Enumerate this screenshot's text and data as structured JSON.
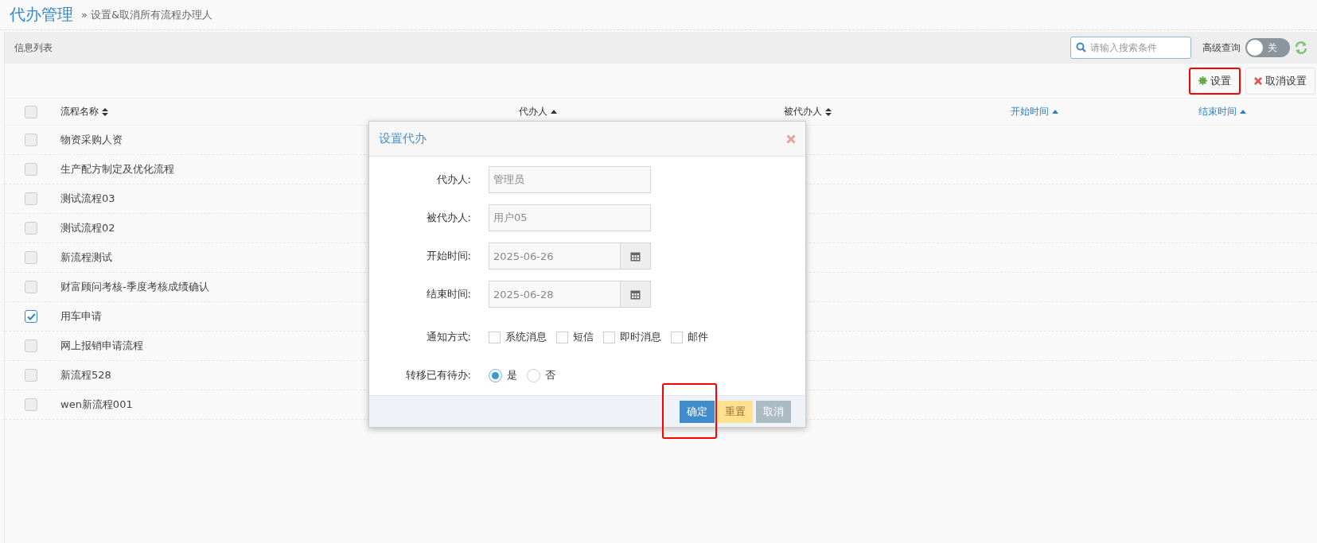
{
  "page": {
    "title": "代办管理",
    "breadcrumb": "» 设置&取消所有流程办理人"
  },
  "panel": {
    "title": "信息列表",
    "search": {
      "placeholder": "请输入搜索条件"
    },
    "advanced_query": {
      "label": "高级查询",
      "on": false,
      "toggle_text": "关"
    }
  },
  "toolbar": [
    {
      "label": "设置",
      "kind": "set",
      "highlighted": true
    },
    {
      "label": "取消设置",
      "kind": "cancel",
      "highlighted": false
    }
  ],
  "table": {
    "all_checked": false,
    "columns": [
      {
        "label": "流程名称",
        "ascending": false
      },
      {
        "label": "代办人",
        "ascending": true
      },
      {
        "label": "被代办人",
        "ascending": false
      },
      {
        "label": "开始时间",
        "ascending": true
      },
      {
        "label": "结束时间",
        "ascending": true
      }
    ],
    "rows": [
      {
        "name": "物资采购人资",
        "checked": false
      },
      {
        "name": "生产配方制定及优化流程",
        "checked": false
      },
      {
        "name": "测试流程03",
        "checked": false
      },
      {
        "name": "测试流程02",
        "checked": false
      },
      {
        "name": "新流程测试",
        "checked": false
      },
      {
        "name": "财富顾问考核-季度考核成绩确认",
        "checked": false
      },
      {
        "name": "用车申请",
        "checked": true
      },
      {
        "name": "网上报销申请流程",
        "checked": false
      },
      {
        "name": "新流程528",
        "checked": false
      },
      {
        "name": "wen新流程001",
        "checked": false
      }
    ]
  },
  "dialog": {
    "title": "设置代办",
    "fields": [
      {
        "label": "代办人:",
        "value": "管理员",
        "kind": "text"
      },
      {
        "label": "被代办人:",
        "value": "用户05",
        "kind": "text"
      },
      {
        "label": "开始时间:",
        "value": "2025-06-26",
        "kind": "date"
      },
      {
        "label": "结束时间:",
        "value": "2025-06-28",
        "kind": "date"
      }
    ],
    "notify": {
      "label": "通知方式:",
      "options": [
        {
          "label": "系统消息",
          "checked": false
        },
        {
          "label": "短信",
          "checked": false
        },
        {
          "label": "即时消息",
          "checked": false
        },
        {
          "label": "邮件",
          "checked": false
        }
      ]
    },
    "transfer": {
      "label": "转移已有待办:",
      "options": [
        {
          "label": "是",
          "selected": true
        },
        {
          "label": "否",
          "selected": false
        }
      ]
    },
    "buttons": [
      {
        "label": "确定",
        "kind": "primary",
        "highlighted": true
      },
      {
        "label": "重置",
        "kind": "warning",
        "highlighted": false
      },
      {
        "label": "取消",
        "kind": "muted",
        "highlighted": false
      }
    ]
  }
}
